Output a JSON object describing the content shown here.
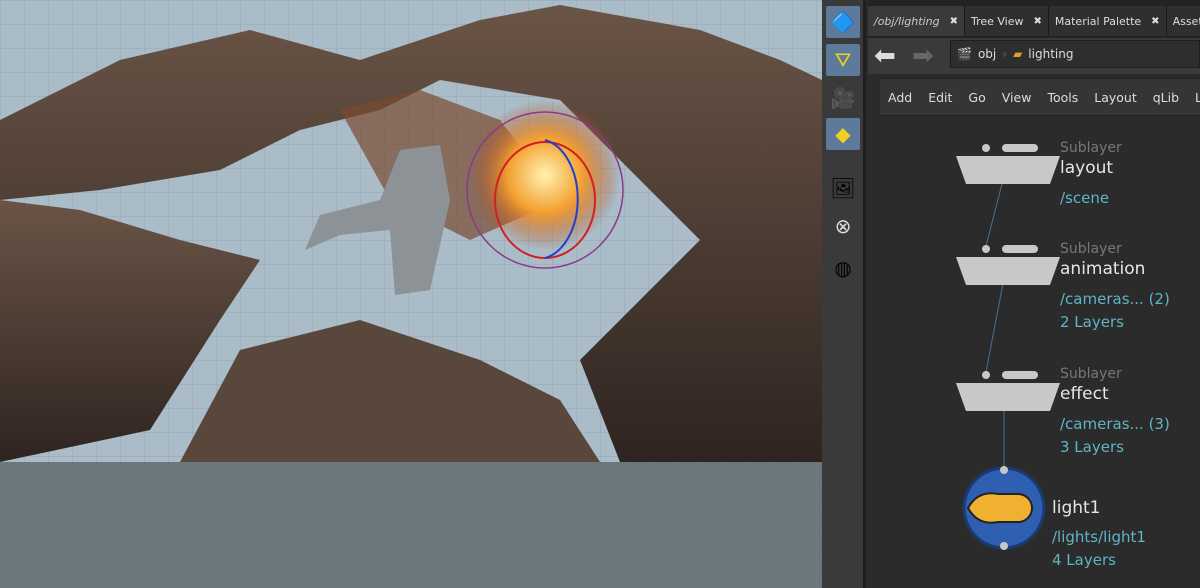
{
  "tabs": [
    {
      "label": "/obj/lighting",
      "active": true
    },
    {
      "label": "Tree View"
    },
    {
      "label": "Material Palette"
    },
    {
      "label": "Asset Brow"
    }
  ],
  "breadcrumb": {
    "root": "obj",
    "current": "lighting"
  },
  "menu": [
    "Add",
    "Edit",
    "Go",
    "View",
    "Tools",
    "Layout",
    "qLib",
    "Labs"
  ],
  "nodes": [
    {
      "type": "Sublayer",
      "name": "layout",
      "info1": "/scene",
      "info2": ""
    },
    {
      "type": "Sublayer",
      "name": "animation",
      "info1": "/cameras... (2)",
      "info2": "2 Layers"
    },
    {
      "type": "Sublayer",
      "name": "effect",
      "info1": "/cameras... (3)",
      "info2": "3 Layers"
    },
    {
      "type": "",
      "name": "light1",
      "info1": "/lights/light1",
      "info2": "4 Layers"
    }
  ],
  "colors": {
    "accent": "#5fb5c5",
    "shelf_active": "#5d7a9a",
    "wire": "#4a6e96"
  }
}
